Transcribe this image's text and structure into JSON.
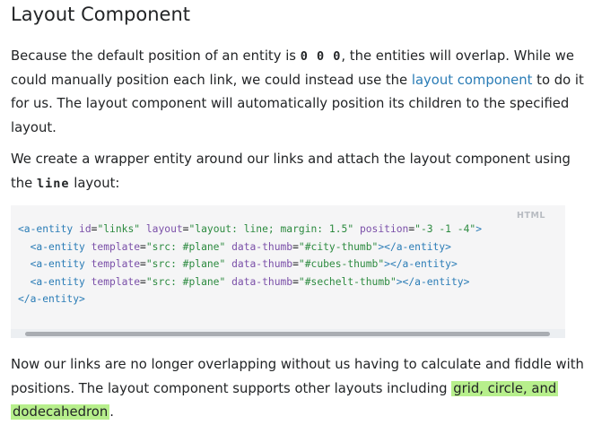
{
  "heading": "Layout Component",
  "p1": {
    "t1": "Because the default position of an entity is ",
    "code": "0 0 0",
    "t2": ", the entities will overlap. While we could manually position each link, we could instead use the ",
    "link": "layout component",
    "t3": " to do it for us. The layout component will automatically position its children to the specified layout."
  },
  "p2": {
    "t1": "We create a wrapper entity around our links and attach the layout component using the ",
    "code": "line",
    "t2": " layout:"
  },
  "code_block": {
    "lang": "HTML",
    "lines": [
      [
        {
          "c": "tag",
          "t": "<a-entity "
        },
        {
          "c": "attr",
          "t": "id"
        },
        {
          "c": "plain",
          "t": "="
        },
        {
          "c": "str",
          "t": "\"links\""
        },
        {
          "c": "plain",
          "t": " "
        },
        {
          "c": "attr",
          "t": "layout"
        },
        {
          "c": "plain",
          "t": "="
        },
        {
          "c": "str",
          "t": "\"layout: line; margin: 1.5\""
        },
        {
          "c": "plain",
          "t": " "
        },
        {
          "c": "attr",
          "t": "position"
        },
        {
          "c": "plain",
          "t": "="
        },
        {
          "c": "str",
          "t": "\"-3 -1 -4\""
        },
        {
          "c": "tag",
          "t": ">"
        }
      ],
      [
        {
          "c": "plain",
          "t": "  "
        },
        {
          "c": "tag",
          "t": "<a-entity "
        },
        {
          "c": "attr",
          "t": "template"
        },
        {
          "c": "plain",
          "t": "="
        },
        {
          "c": "str",
          "t": "\"src: #plane\""
        },
        {
          "c": "plain",
          "t": " "
        },
        {
          "c": "attr",
          "t": "data-thumb"
        },
        {
          "c": "plain",
          "t": "="
        },
        {
          "c": "str",
          "t": "\"#city-thumb\""
        },
        {
          "c": "tag",
          "t": "></a-entity>"
        }
      ],
      [
        {
          "c": "plain",
          "t": "  "
        },
        {
          "c": "tag",
          "t": "<a-entity "
        },
        {
          "c": "attr",
          "t": "template"
        },
        {
          "c": "plain",
          "t": "="
        },
        {
          "c": "str",
          "t": "\"src: #plane\""
        },
        {
          "c": "plain",
          "t": " "
        },
        {
          "c": "attr",
          "t": "data-thumb"
        },
        {
          "c": "plain",
          "t": "="
        },
        {
          "c": "str",
          "t": "\"#cubes-thumb\""
        },
        {
          "c": "tag",
          "t": "></a-entity>"
        }
      ],
      [
        {
          "c": "plain",
          "t": "  "
        },
        {
          "c": "tag",
          "t": "<a-entity "
        },
        {
          "c": "attr",
          "t": "template"
        },
        {
          "c": "plain",
          "t": "="
        },
        {
          "c": "str",
          "t": "\"src: #plane\""
        },
        {
          "c": "plain",
          "t": " "
        },
        {
          "c": "attr",
          "t": "data-thumb"
        },
        {
          "c": "plain",
          "t": "="
        },
        {
          "c": "str",
          "t": "\"#sechelt-thumb\""
        },
        {
          "c": "tag",
          "t": "></a-entity>"
        }
      ],
      [
        {
          "c": "tag",
          "t": "</a-entity>"
        }
      ]
    ]
  },
  "p3": {
    "t1": "Now our links are no longer overlapping without us having to calculate and fiddle with positions. The layout component supports other layouts including ",
    "hl1": "grid, circle, and",
    "t2": " ",
    "hl2": "dodecahedron",
    "t3": "."
  },
  "colors": {
    "link": "#2a7cb6",
    "highlight": "#b7ef8c",
    "code_bg": "#f5f5f6",
    "tag": "#2a7cb6",
    "attr": "#7a4fa8",
    "string": "#2c8a3f"
  }
}
